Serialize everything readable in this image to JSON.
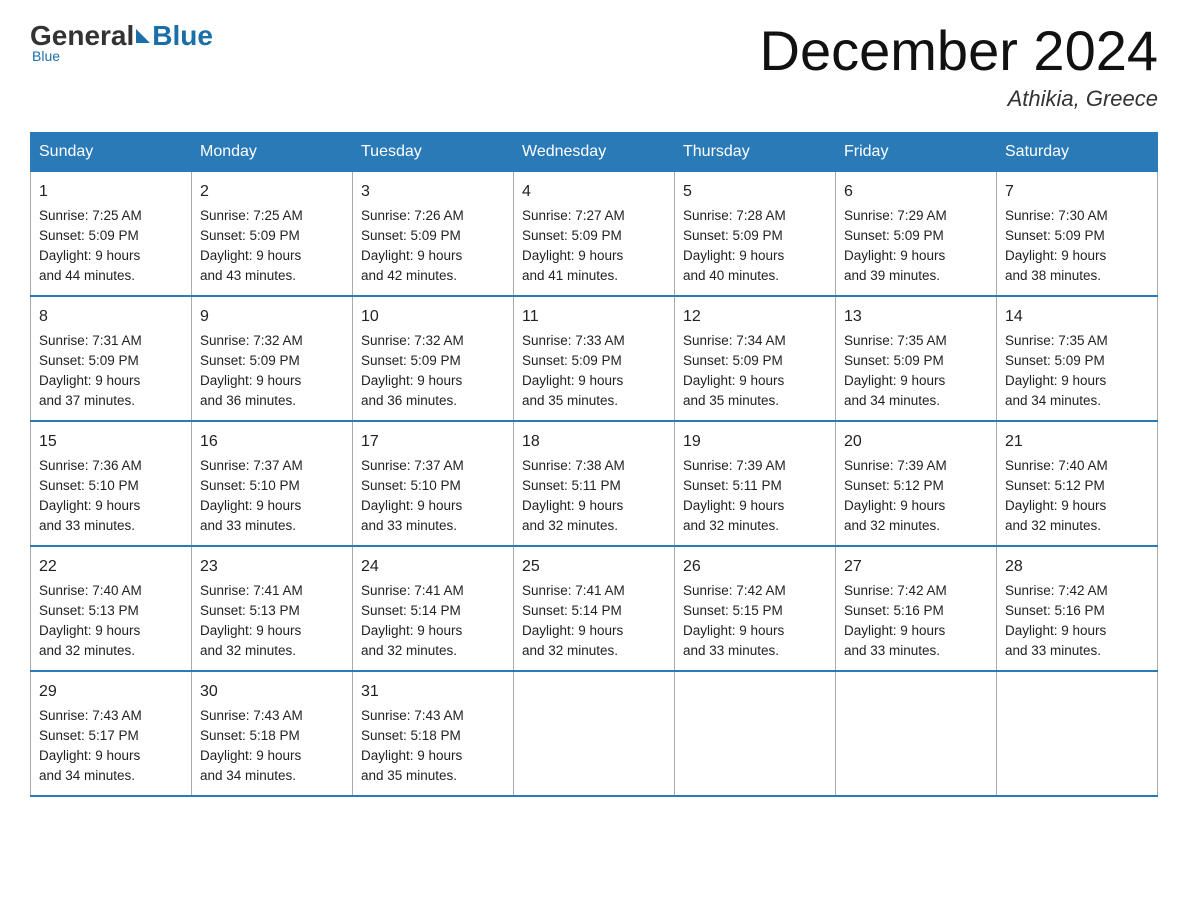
{
  "header": {
    "logo_general": "General",
    "logo_blue": "Blue",
    "month_title": "December 2024",
    "location": "Athikia, Greece"
  },
  "days_of_week": [
    "Sunday",
    "Monday",
    "Tuesday",
    "Wednesday",
    "Thursday",
    "Friday",
    "Saturday"
  ],
  "weeks": [
    [
      {
        "day": "1",
        "sunrise": "7:25 AM",
        "sunset": "5:09 PM",
        "daylight": "9 hours and 44 minutes."
      },
      {
        "day": "2",
        "sunrise": "7:25 AM",
        "sunset": "5:09 PM",
        "daylight": "9 hours and 43 minutes."
      },
      {
        "day": "3",
        "sunrise": "7:26 AM",
        "sunset": "5:09 PM",
        "daylight": "9 hours and 42 minutes."
      },
      {
        "day": "4",
        "sunrise": "7:27 AM",
        "sunset": "5:09 PM",
        "daylight": "9 hours and 41 minutes."
      },
      {
        "day": "5",
        "sunrise": "7:28 AM",
        "sunset": "5:09 PM",
        "daylight": "9 hours and 40 minutes."
      },
      {
        "day": "6",
        "sunrise": "7:29 AM",
        "sunset": "5:09 PM",
        "daylight": "9 hours and 39 minutes."
      },
      {
        "day": "7",
        "sunrise": "7:30 AM",
        "sunset": "5:09 PM",
        "daylight": "9 hours and 38 minutes."
      }
    ],
    [
      {
        "day": "8",
        "sunrise": "7:31 AM",
        "sunset": "5:09 PM",
        "daylight": "9 hours and 37 minutes."
      },
      {
        "day": "9",
        "sunrise": "7:32 AM",
        "sunset": "5:09 PM",
        "daylight": "9 hours and 36 minutes."
      },
      {
        "day": "10",
        "sunrise": "7:32 AM",
        "sunset": "5:09 PM",
        "daylight": "9 hours and 36 minutes."
      },
      {
        "day": "11",
        "sunrise": "7:33 AM",
        "sunset": "5:09 PM",
        "daylight": "9 hours and 35 minutes."
      },
      {
        "day": "12",
        "sunrise": "7:34 AM",
        "sunset": "5:09 PM",
        "daylight": "9 hours and 35 minutes."
      },
      {
        "day": "13",
        "sunrise": "7:35 AM",
        "sunset": "5:09 PM",
        "daylight": "9 hours and 34 minutes."
      },
      {
        "day": "14",
        "sunrise": "7:35 AM",
        "sunset": "5:09 PM",
        "daylight": "9 hours and 34 minutes."
      }
    ],
    [
      {
        "day": "15",
        "sunrise": "7:36 AM",
        "sunset": "5:10 PM",
        "daylight": "9 hours and 33 minutes."
      },
      {
        "day": "16",
        "sunrise": "7:37 AM",
        "sunset": "5:10 PM",
        "daylight": "9 hours and 33 minutes."
      },
      {
        "day": "17",
        "sunrise": "7:37 AM",
        "sunset": "5:10 PM",
        "daylight": "9 hours and 33 minutes."
      },
      {
        "day": "18",
        "sunrise": "7:38 AM",
        "sunset": "5:11 PM",
        "daylight": "9 hours and 32 minutes."
      },
      {
        "day": "19",
        "sunrise": "7:39 AM",
        "sunset": "5:11 PM",
        "daylight": "9 hours and 32 minutes."
      },
      {
        "day": "20",
        "sunrise": "7:39 AM",
        "sunset": "5:12 PM",
        "daylight": "9 hours and 32 minutes."
      },
      {
        "day": "21",
        "sunrise": "7:40 AM",
        "sunset": "5:12 PM",
        "daylight": "9 hours and 32 minutes."
      }
    ],
    [
      {
        "day": "22",
        "sunrise": "7:40 AM",
        "sunset": "5:13 PM",
        "daylight": "9 hours and 32 minutes."
      },
      {
        "day": "23",
        "sunrise": "7:41 AM",
        "sunset": "5:13 PM",
        "daylight": "9 hours and 32 minutes."
      },
      {
        "day": "24",
        "sunrise": "7:41 AM",
        "sunset": "5:14 PM",
        "daylight": "9 hours and 32 minutes."
      },
      {
        "day": "25",
        "sunrise": "7:41 AM",
        "sunset": "5:14 PM",
        "daylight": "9 hours and 32 minutes."
      },
      {
        "day": "26",
        "sunrise": "7:42 AM",
        "sunset": "5:15 PM",
        "daylight": "9 hours and 33 minutes."
      },
      {
        "day": "27",
        "sunrise": "7:42 AM",
        "sunset": "5:16 PM",
        "daylight": "9 hours and 33 minutes."
      },
      {
        "day": "28",
        "sunrise": "7:42 AM",
        "sunset": "5:16 PM",
        "daylight": "9 hours and 33 minutes."
      }
    ],
    [
      {
        "day": "29",
        "sunrise": "7:43 AM",
        "sunset": "5:17 PM",
        "daylight": "9 hours and 34 minutes."
      },
      {
        "day": "30",
        "sunrise": "7:43 AM",
        "sunset": "5:18 PM",
        "daylight": "9 hours and 34 minutes."
      },
      {
        "day": "31",
        "sunrise": "7:43 AM",
        "sunset": "5:18 PM",
        "daylight": "9 hours and 35 minutes."
      },
      null,
      null,
      null,
      null
    ]
  ],
  "labels": {
    "sunrise": "Sunrise:",
    "sunset": "Sunset:",
    "daylight": "Daylight:"
  }
}
